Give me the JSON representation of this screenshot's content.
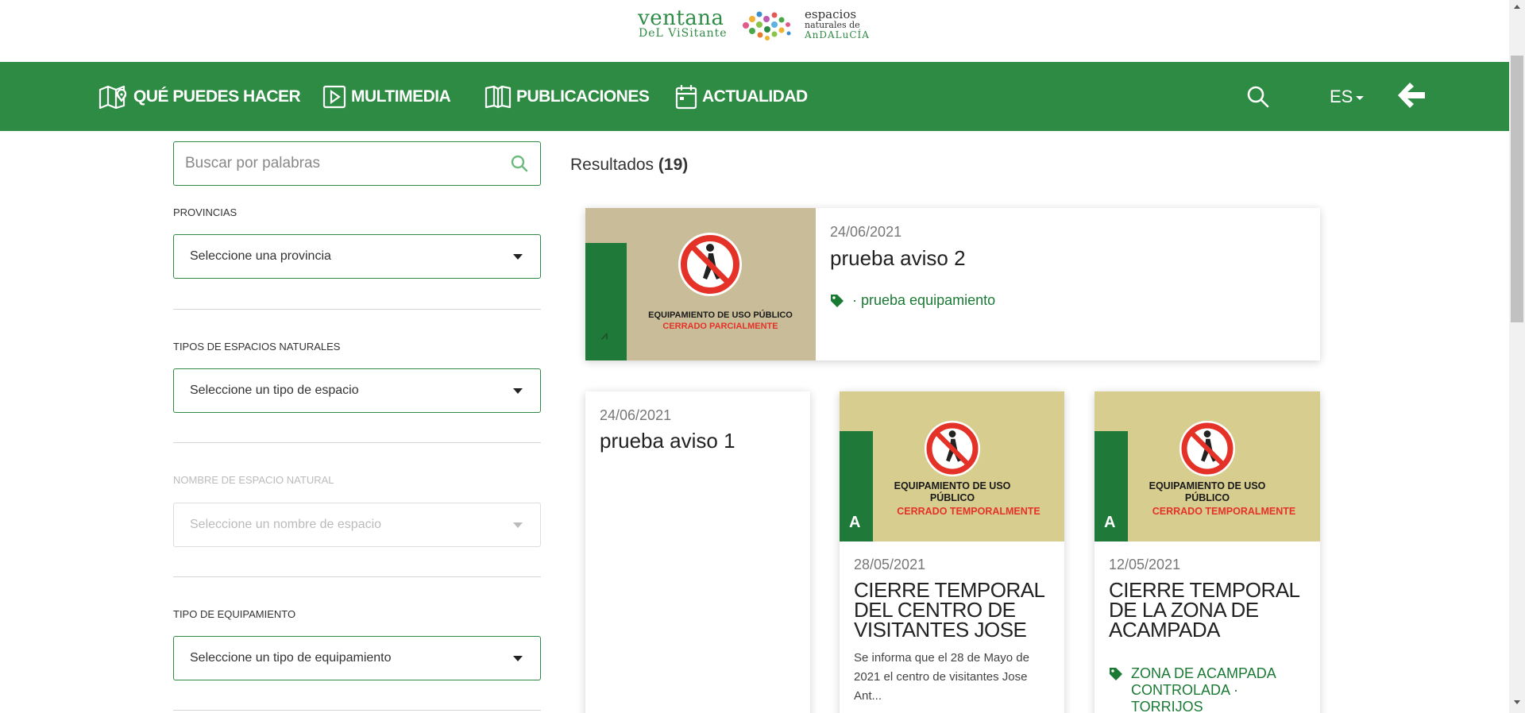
{
  "logo": {
    "line1": "ventana",
    "line2": "DeL ViSitante",
    "line3a": "espacios",
    "line3b": "naturales de",
    "line3c": "AnDALuCÍA"
  },
  "nav": {
    "items": [
      {
        "label": "QUÉ PUEDES HACER",
        "icon": "map-pin-icon"
      },
      {
        "label": "MULTIMEDIA",
        "icon": "play-icon"
      },
      {
        "label": "PUBLICACIONES",
        "icon": "book-icon"
      },
      {
        "label": "ACTUALIDAD",
        "icon": "calendar-icon"
      }
    ],
    "language": "ES"
  },
  "colors": {
    "brand_green": "#2e8b44",
    "tag_green": "#1a7a34",
    "closed_red": "#e53228"
  },
  "search": {
    "placeholder": "Buscar por palabras"
  },
  "filters": {
    "provincias": {
      "label": "PROVINCIAS",
      "value": "Seleccione una provincia"
    },
    "tipos_espacios": {
      "label": "TIPOS DE ESPACIOS NATURALES",
      "value": "Seleccione un tipo de espacio"
    },
    "nombre_espacio": {
      "label": "NOMBRE DE ESPACIO NATURAL",
      "value": "Seleccione un nombre de espacio"
    },
    "tipo_equipamiento": {
      "label": "TIPO DE EQUIPAMIENTO",
      "value": "Seleccione un tipo de equipamiento"
    }
  },
  "results": {
    "label": "Resultados",
    "count": "(19)"
  },
  "cards": [
    {
      "date": "24/06/2021",
      "title": "prueba aviso 2",
      "tag": "· prueba equipamiento",
      "image": {
        "line1": "EQUIPAMIENTO DE USO PÚBLICO",
        "line2": "CERRADO PARCIALMENTE"
      }
    },
    {
      "date": "24/06/2021",
      "title": "prueba aviso 1"
    },
    {
      "date": "28/05/2021",
      "title": "CIERRE TEMPORAL DEL CENTRO DE VISITANTES JOSE",
      "text": "Se informa que el 28 de Mayo de 2021 el centro de visitantes Jose Ant...",
      "image": {
        "line1": "EQUIPAMIENTO DE USO PÚBLICO",
        "line2": "CERRADO TEMPORALMENTE"
      }
    },
    {
      "date": "12/05/2021",
      "title": "CIERRE TEMPORAL DE LA ZONA DE ACAMPADA",
      "tag": "ZONA DE ACAMPADA CONTROLADA · TORRIJOS",
      "image": {
        "line1": "EQUIPAMIENTO DE USO PÚBLICO",
        "line2": "CERRADO TEMPORALMENTE"
      }
    }
  ]
}
